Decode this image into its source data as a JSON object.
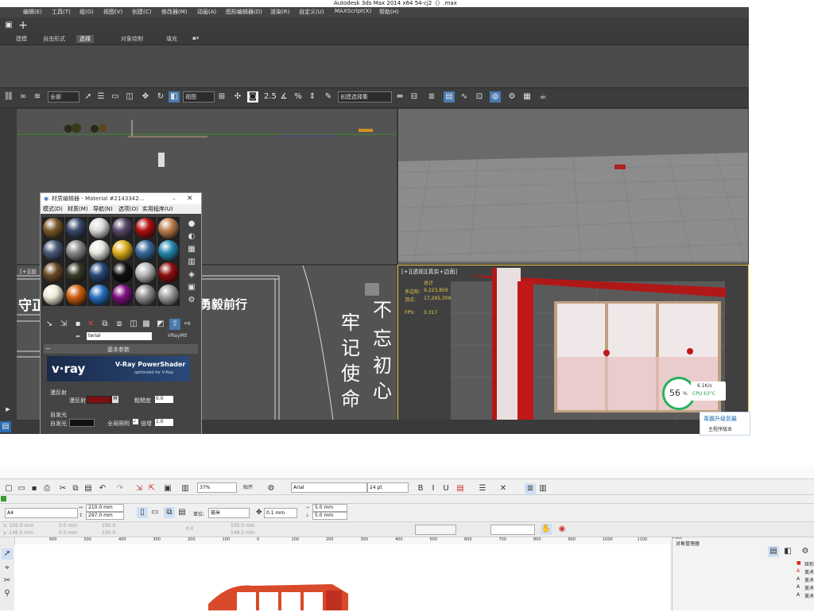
{
  "max": {
    "title": "Autodesk 3ds Max  2014 x64      54-cj2（）.max",
    "menus": [
      "编辑(E)",
      "工具(T)",
      "组(G)",
      "视图(V)",
      "创建(C)",
      "修改器(M)",
      "动画(A)",
      "图形编辑器(D)",
      "渲染(R)",
      "自定义(U)",
      "MAXScript(X)",
      "帮助(H)"
    ],
    "ribbon_tabs": [
      "建模",
      "自由形式",
      "选择",
      "对象绘制",
      "填充"
    ],
    "active_ribbon_tab": "选择",
    "toolbar": {
      "filter_dropdown": "全部",
      "ref_coord_dropdown": "视图",
      "selection_set_dropdown": "创建选择集"
    },
    "viewport_camera": {
      "label": "[+][透视][真实+边面]",
      "stats_total": "总计",
      "polys_label": "多边形:",
      "polys_value": "9,223,859",
      "verts_label": "顶点:",
      "verts_value": "17,265,309",
      "fps_label": "FPS:",
      "fps_value": "0.317"
    },
    "viewport_front_label": "[+][前",
    "signage_text": {
      "side_banner": "勇毅前行",
      "chars": [
        "不",
        "忘",
        "初",
        "心",
        "牢",
        "记",
        "使",
        "命"
      ],
      "left_text": "守正"
    },
    "perf_widget": {
      "percent": "56",
      "percent_sign": "%",
      "speed": "6.1K/s",
      "cpu": "CPU 63°C"
    },
    "notice": {
      "title": "毒霸升级到最",
      "sub": "主程序版本"
    }
  },
  "material_editor": {
    "title": "材质编辑器 - Material #2143342...",
    "menus": [
      "模式(D)",
      "材质(M)",
      "导航(N)",
      "选项(O)",
      "实用程序(U)"
    ],
    "material_name": "terial #2143342453666561",
    "material_type": "VRayMtl",
    "rollout_title": "基本参数",
    "vray_brand": "v·ray",
    "vray_product": "V-Ray PowerShader",
    "vray_sub": "optimized for V-Ray",
    "diffuse_group": "漫反射",
    "diffuse_label": "漫反射",
    "diffuse_map_btn": "M",
    "roughness_label": "粗糙度",
    "roughness_value": "0.0",
    "selfillum_group": "自发光",
    "selfillum_label": "自发光",
    "gi_label": "全局照明",
    "multiplier_label": "倍增",
    "multiplier_value": "1.0",
    "spheres": [
      {
        "color": "#7a5a2a"
      },
      {
        "color": "#3a4a6a"
      },
      {
        "color": "#dcdcdc"
      },
      {
        "color": "#5a4a6a"
      },
      {
        "color": "#b01010"
      },
      {
        "color": "#c08050"
      },
      {
        "color": "#4a5a7a"
      },
      {
        "color": "#8a8a8a"
      },
      {
        "color": "#e8e8e0"
      },
      {
        "color": "#e0b020"
      },
      {
        "color": "#3a6a9a"
      },
      {
        "color": "#2a8ab0"
      },
      {
        "color": "#6a4a2a"
      },
      {
        "color": "#3a3a2a"
      },
      {
        "color": "#2a4a7a"
      },
      {
        "color": "#111111"
      },
      {
        "color": "#b8b8b8"
      },
      {
        "color": "#901010"
      },
      {
        "color": "#f0e8d8"
      },
      {
        "color": "#d06010"
      },
      {
        "color": "#2a70c0"
      },
      {
        "color": "#801080"
      },
      {
        "color": "#909090"
      },
      {
        "color": "#a0a0a0"
      }
    ]
  },
  "corel": {
    "zoom": "37%",
    "snap_label": "贴齐",
    "font_name": "Arial",
    "font_size": "24 pt",
    "page_size": "A4",
    "width": "210.0 mm",
    "height": "297.0 mm",
    "units_label": "单位:",
    "units": "毫米",
    "nudge": "0.1 mm",
    "dup_x": "5.0 mm",
    "dup_y": "5.0 mm",
    "pos_x": "x: 105.0 mm",
    "pos_y": "y: 148.5 mm",
    "size_w": "0.0 mm",
    "size_h": "0.0 mm",
    "scale_w": "100.0",
    "scale_h": "100.0",
    "angle": "0.0",
    "ox": "105.0 mm",
    "oy": "148.5 mm",
    "ruler": [
      "600",
      "500",
      "400",
      "300",
      "200",
      "100",
      "0",
      "100",
      "200",
      "300",
      "400",
      "500",
      "600",
      "700",
      "800",
      "900",
      "1000",
      "1100",
      "1200"
    ],
    "obj_manager_title": "对象管理器",
    "obj_items": [
      "矩形",
      "美术",
      "美术",
      "美术",
      "美术"
    ]
  }
}
